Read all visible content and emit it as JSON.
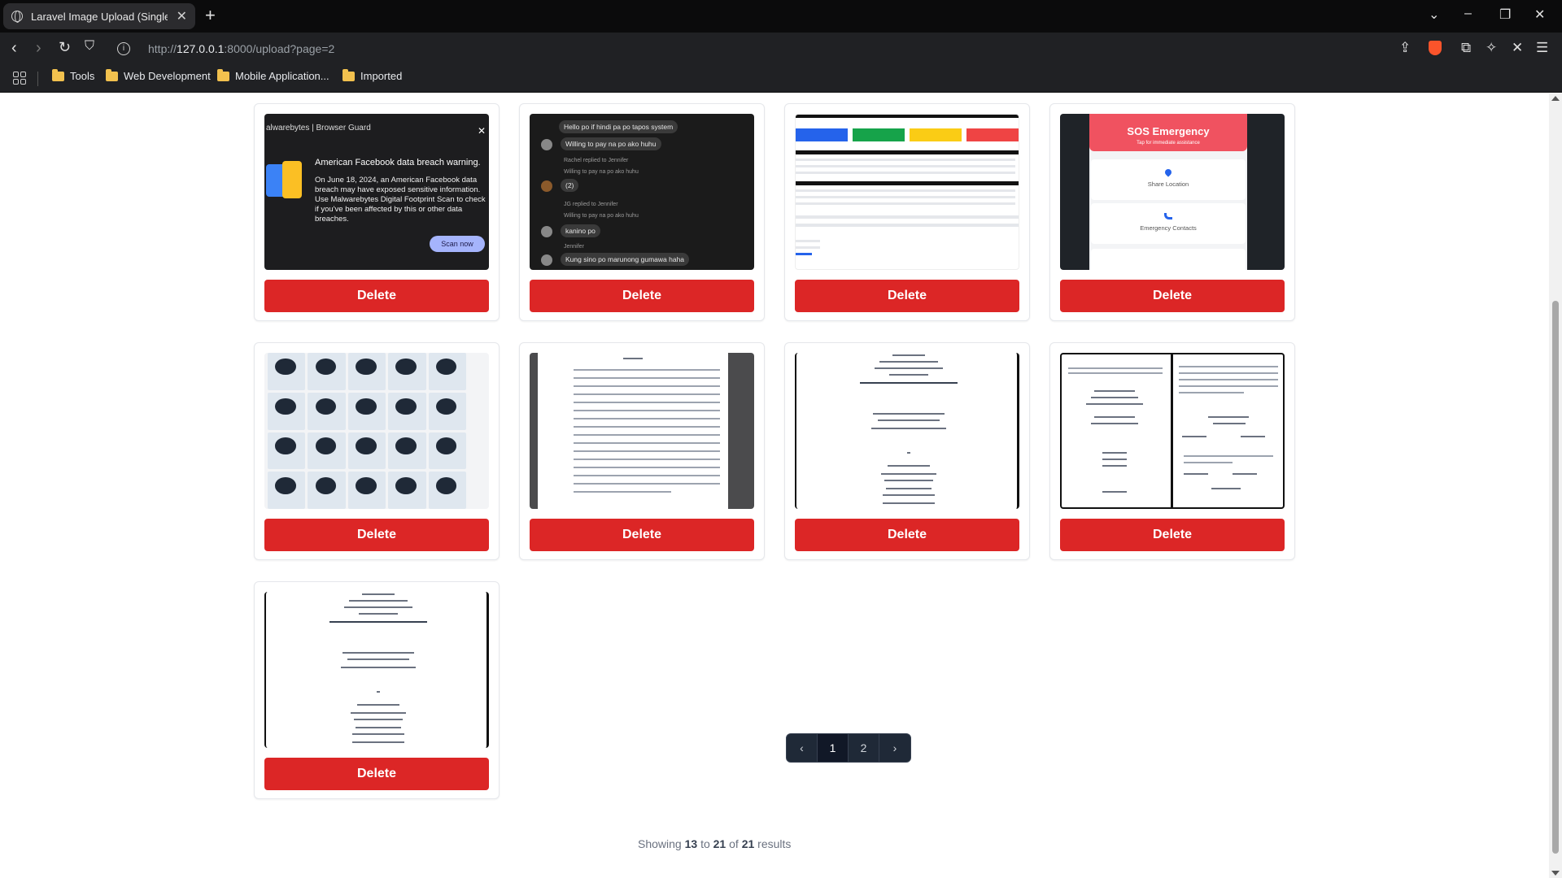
{
  "browser": {
    "tab_title": "Laravel Image Upload (Single -",
    "tab_close": "✕",
    "new_tab": "+",
    "url_prefix": "http://",
    "url_host": "127.0.0.1",
    "url_rest": ":8000/upload?page=2",
    "bookmarks": [
      "Tools",
      "Web Development",
      "Mobile Application...",
      "Imported"
    ]
  },
  "cards": [
    {
      "thumb": "malwarebytes",
      "delete_label": "Delete"
    },
    {
      "thumb": "chat",
      "delete_label": "Delete"
    },
    {
      "thumb": "dashboard",
      "delete_label": "Delete"
    },
    {
      "thumb": "sos",
      "delete_label": "Delete"
    },
    {
      "thumb": "products",
      "delete_label": "Delete"
    },
    {
      "thumb": "abstract-doc",
      "delete_label": "Delete"
    },
    {
      "thumb": "title-page",
      "delete_label": "Delete"
    },
    {
      "thumb": "two-page-doc",
      "delete_label": "Delete"
    },
    {
      "thumb": "title-page-2",
      "delete_label": "Delete"
    }
  ],
  "thumb_text": {
    "mw_header": "alwarebytes | Browser Guard",
    "mw_heading": "American Facebook data breach warning.",
    "mw_body": "On June 18, 2024, an American Facebook data breach may have exposed sensitive information. Use Malwarebytes Digital Footprint Scan to check if you've been affected by this or other data breaches.",
    "mw_button": "Scan now",
    "chat_1": "Hello po if hindi pa po tapos system",
    "chat_2": "Willing to pay na po ako huhu",
    "chat_meta_1": "Rachel replied to Jennifer",
    "chat_meta_2": "Willing to pay na po ako huhu",
    "chat_3": "(2)",
    "chat_meta_3": "JG replied to Jennifer",
    "chat_meta_4": "Willing to pay na po ako huhu",
    "chat_4": "kanino po",
    "chat_meta_5": "Jennifer",
    "chat_5": "Kung sino po marunong gumawa haha",
    "sos_title": "SOS Emergency",
    "sos_sub": "Tap for immediate assistance",
    "sos_item_1": "Share Location",
    "sos_item_2": "Emergency Contacts"
  },
  "pagination": {
    "showing": "Showing",
    "from": "13",
    "to_word": "to",
    "to": "21",
    "of_word": "of",
    "total": "21",
    "results": "results",
    "prev": "‹",
    "pages": [
      "1",
      "2"
    ],
    "next": "›",
    "current": "2"
  },
  "colors": {
    "delete_button": "#dc2626",
    "pager_bg": "#1f2937"
  }
}
